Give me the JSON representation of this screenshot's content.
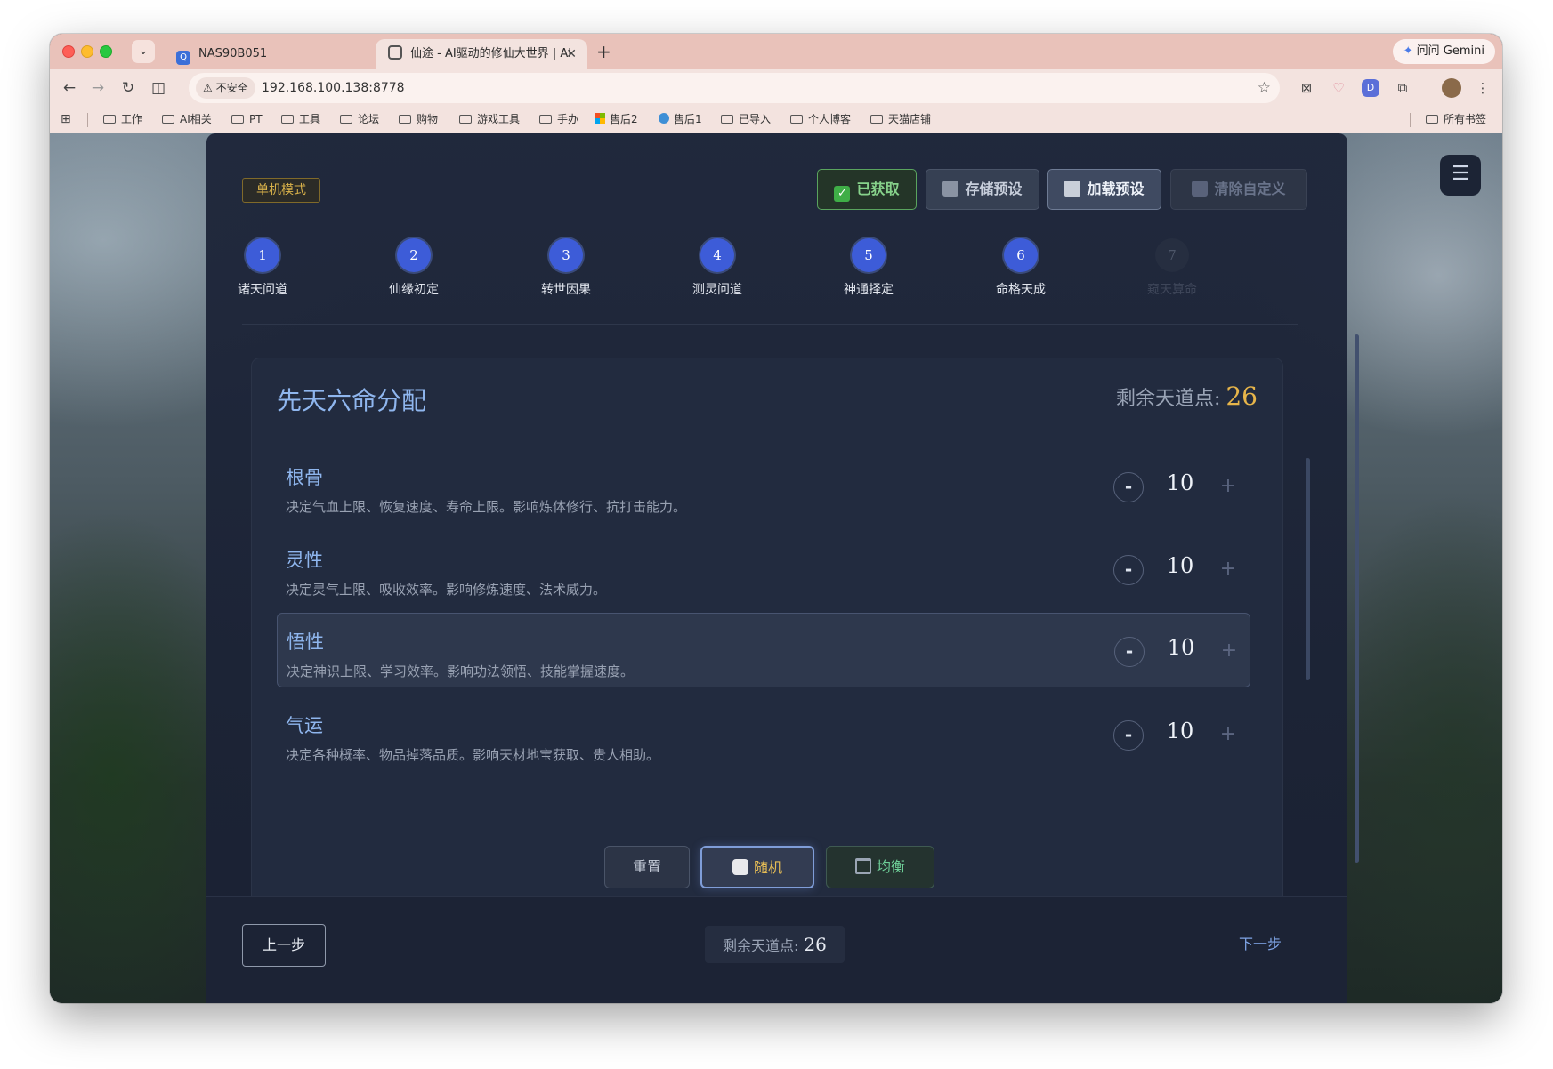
{
  "browser": {
    "tabs": [
      {
        "title": "NAS90B051"
      },
      {
        "title": "仙途 - AI驱动的修仙大世界 | AI"
      }
    ],
    "gemini_label": "问问 Gemini",
    "security_label": "不安全",
    "url": "192.168.100.138:8778",
    "bookmarks": [
      "工作",
      "AI相关",
      "PT",
      "工具",
      "论坛",
      "购物",
      "游戏工具",
      "手办",
      "售后2",
      "售后1",
      "已导入",
      "个人博客",
      "天猫店铺"
    ],
    "all_bookmarks": "所有书签"
  },
  "header": {
    "mode_badge": "单机模式",
    "acquired_label": "已获取",
    "save_preset_label": "存储预设",
    "load_preset_label": "加载预设",
    "clear_custom_label": "清除自定义"
  },
  "steps": [
    {
      "num": "1",
      "label": "诸天问道",
      "active": true
    },
    {
      "num": "2",
      "label": "仙缘初定",
      "active": true
    },
    {
      "num": "3",
      "label": "转世因果",
      "active": true
    },
    {
      "num": "4",
      "label": "测灵问道",
      "active": true
    },
    {
      "num": "5",
      "label": "神通择定",
      "active": true
    },
    {
      "num": "6",
      "label": "命格天成",
      "active": true
    },
    {
      "num": "7",
      "label": "窥天算命",
      "active": false
    }
  ],
  "allocation": {
    "title": "先天六命分配",
    "remaining_label": "剩余天道点:",
    "remaining_value": "26",
    "attributes": [
      {
        "name": "根骨",
        "desc": "决定气血上限、恢复速度、寿命上限。影响炼体修行、抗打击能力。",
        "value": "10",
        "minus": "-",
        "plus": "+"
      },
      {
        "name": "灵性",
        "desc": "决定灵气上限、吸收效率。影响修炼速度、法术威力。",
        "value": "10",
        "minus": "-",
        "plus": "+"
      },
      {
        "name": "悟性",
        "desc": "决定神识上限、学习效率。影响功法领悟、技能掌握速度。",
        "value": "10",
        "minus": "-",
        "plus": "+"
      },
      {
        "name": "气运",
        "desc": "决定各种概率、物品掉落品质。影响天材地宝获取、贵人相助。",
        "value": "10",
        "minus": "-",
        "plus": "+"
      }
    ],
    "reset_label": "重置",
    "random_label": "随机",
    "balance_label": "均衡"
  },
  "footer": {
    "prev_label": "上一步",
    "remaining_label": "剩余天道点:",
    "remaining_value": "26",
    "next_label": "下一步"
  },
  "colors": {
    "accent_blue": "#3d5cd8",
    "title_blue": "#8fb6ee",
    "points_gold": "#e7b54a",
    "acquired_green": "#87d28b"
  }
}
